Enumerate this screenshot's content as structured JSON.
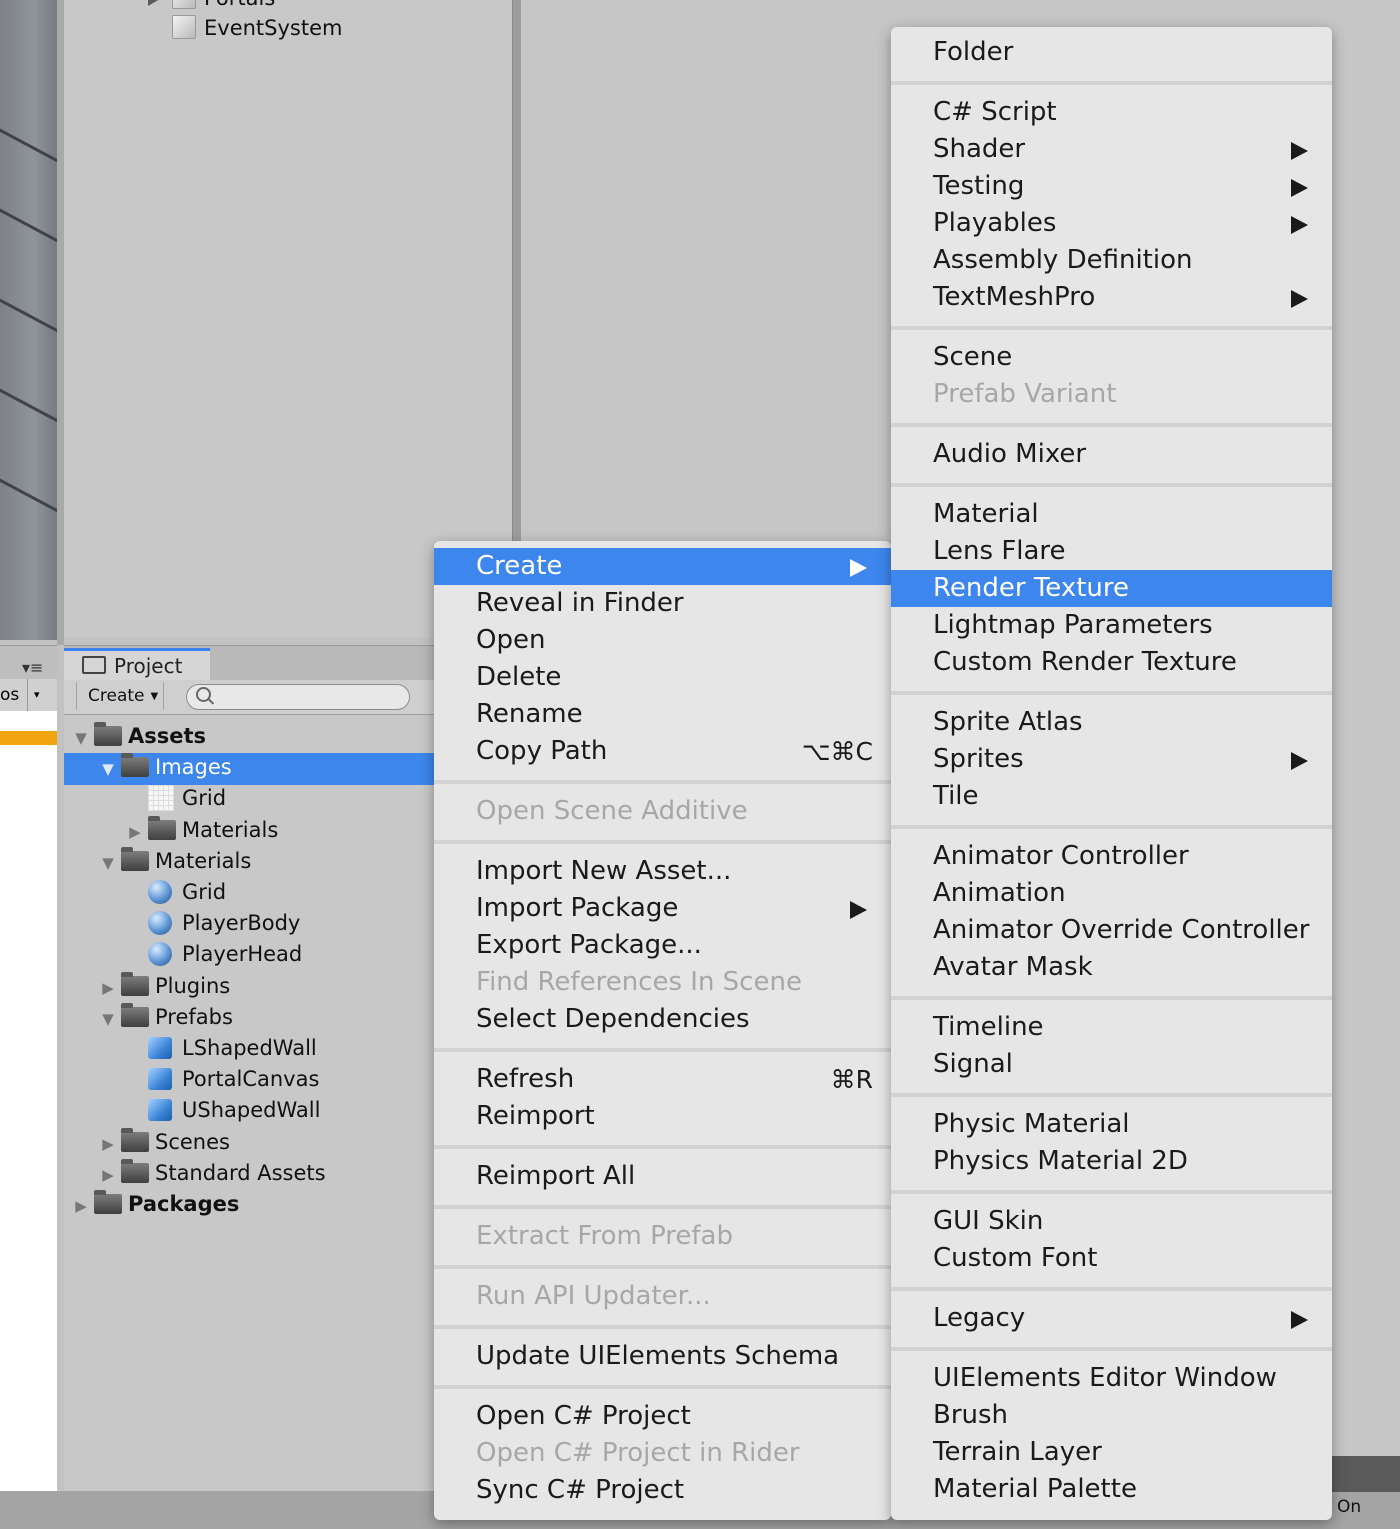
{
  "hierarchy": {
    "items": [
      "Portals",
      "EventSystem"
    ]
  },
  "left_panel": {
    "row_text": "os"
  },
  "project": {
    "tab_label": "Project",
    "create_label": "Create",
    "search_placeholder": "",
    "tree": [
      {
        "label": "Assets",
        "arrow": "▼",
        "icon": "folder",
        "level": 0,
        "bold": true
      },
      {
        "label": "Images",
        "arrow": "▼",
        "icon": "folder",
        "level": 1,
        "selected": true
      },
      {
        "label": "Grid",
        "arrow": "",
        "icon": "texture",
        "level": 2
      },
      {
        "label": "Materials",
        "arrow": "▶",
        "icon": "folder",
        "level": 2
      },
      {
        "label": "Materials",
        "arrow": "▼",
        "icon": "folder",
        "level": 1
      },
      {
        "label": "Grid",
        "arrow": "",
        "icon": "material",
        "level": 2
      },
      {
        "label": "PlayerBody",
        "arrow": "",
        "icon": "material",
        "level": 2
      },
      {
        "label": "PlayerHead",
        "arrow": "",
        "icon": "material",
        "level": 2
      },
      {
        "label": "Plugins",
        "arrow": "▶",
        "icon": "folder",
        "level": 1
      },
      {
        "label": "Prefabs",
        "arrow": "▼",
        "icon": "folder",
        "level": 1
      },
      {
        "label": "LShapedWall",
        "arrow": "",
        "icon": "prefab",
        "level": 2
      },
      {
        "label": "PortalCanvas",
        "arrow": "",
        "icon": "prefab",
        "level": 2
      },
      {
        "label": "UShapedWall",
        "arrow": "",
        "icon": "prefab",
        "level": 2
      },
      {
        "label": "Scenes",
        "arrow": "▶",
        "icon": "folder",
        "level": 1
      },
      {
        "label": "Standard Assets",
        "arrow": "▶",
        "icon": "folder",
        "level": 1
      },
      {
        "label": "Packages",
        "arrow": "▶",
        "icon": "folder",
        "level": 0,
        "bold": true
      }
    ]
  },
  "context_menu": {
    "items": [
      {
        "label": "Create",
        "submenu": true,
        "highlighted": true
      },
      {
        "label": "Reveal in Finder"
      },
      {
        "label": "Open"
      },
      {
        "label": "Delete"
      },
      {
        "label": "Rename"
      },
      {
        "label": "Copy Path",
        "shortcut": "⌥⌘C"
      },
      {
        "separator": true
      },
      {
        "label": "Open Scene Additive",
        "disabled": true
      },
      {
        "separator": true
      },
      {
        "label": "Import New Asset..."
      },
      {
        "label": "Import Package",
        "submenu": true
      },
      {
        "label": "Export Package..."
      },
      {
        "label": "Find References In Scene",
        "disabled": true
      },
      {
        "label": "Select Dependencies"
      },
      {
        "separator": true
      },
      {
        "label": "Refresh",
        "shortcut": "⌘R"
      },
      {
        "label": "Reimport"
      },
      {
        "separator": true
      },
      {
        "label": "Reimport All"
      },
      {
        "separator": true
      },
      {
        "label": "Extract From Prefab",
        "disabled": true
      },
      {
        "separator": true
      },
      {
        "label": "Run API Updater...",
        "disabled": true
      },
      {
        "separator": true
      },
      {
        "label": "Update UIElements Schema"
      },
      {
        "separator": true
      },
      {
        "label": "Open C# Project"
      },
      {
        "label": "Open C# Project in Rider",
        "disabled": true
      },
      {
        "label": "Sync C# Project"
      }
    ]
  },
  "create_submenu": {
    "items": [
      {
        "label": "Folder"
      },
      {
        "separator": true
      },
      {
        "label": "C# Script"
      },
      {
        "label": "Shader",
        "submenu": true
      },
      {
        "label": "Testing",
        "submenu": true
      },
      {
        "label": "Playables",
        "submenu": true
      },
      {
        "label": "Assembly Definition"
      },
      {
        "label": "TextMeshPro",
        "submenu": true
      },
      {
        "separator": true
      },
      {
        "label": "Scene"
      },
      {
        "label": "Prefab Variant",
        "disabled": true
      },
      {
        "separator": true
      },
      {
        "label": "Audio Mixer"
      },
      {
        "separator": true
      },
      {
        "label": "Material"
      },
      {
        "label": "Lens Flare"
      },
      {
        "label": "Render Texture",
        "highlighted": true
      },
      {
        "label": "Lightmap Parameters"
      },
      {
        "label": "Custom Render Texture"
      },
      {
        "separator": true
      },
      {
        "label": "Sprite Atlas"
      },
      {
        "label": "Sprites",
        "submenu": true
      },
      {
        "label": "Tile"
      },
      {
        "separator": true
      },
      {
        "label": "Animator Controller"
      },
      {
        "label": "Animation"
      },
      {
        "label": "Animator Override Controller"
      },
      {
        "label": "Avatar Mask"
      },
      {
        "separator": true
      },
      {
        "label": "Timeline"
      },
      {
        "label": "Signal"
      },
      {
        "separator": true
      },
      {
        "label": "Physic Material"
      },
      {
        "label": "Physics Material 2D"
      },
      {
        "separator": true
      },
      {
        "label": "GUI Skin"
      },
      {
        "label": "Custom Font"
      },
      {
        "separator": true
      },
      {
        "label": "Legacy",
        "submenu": true
      },
      {
        "separator": true
      },
      {
        "label": "UIElements Editor Window"
      },
      {
        "label": "Brush"
      },
      {
        "label": "Terrain Layer"
      },
      {
        "label": "Material Palette"
      }
    ]
  },
  "status_bar": {
    "right_text": "On"
  },
  "colors": {
    "highlight": "#3d86ee",
    "menu_bg": "#e6e6e6",
    "disabled_text": "#a7a7a7",
    "warning": "#f2a511"
  }
}
